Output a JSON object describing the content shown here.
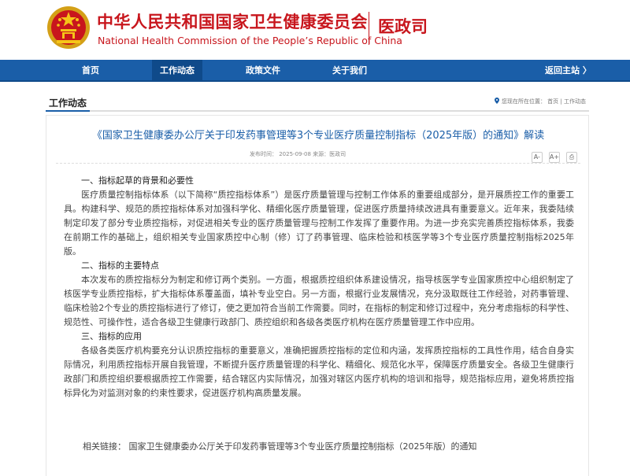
{
  "header": {
    "title_cn": "中华人民共和国国家卫生健康委员会",
    "title_en": "National Health Commission of the People’s Republic of China",
    "department": "医政司"
  },
  "nav": {
    "items": [
      "首页",
      "工作动态",
      "政策文件",
      "关于我们"
    ],
    "back": "返回主站 〉"
  },
  "section": {
    "title": "工作动态",
    "breadcrumb": "您现在所在位置：  首页 | 工作动态"
  },
  "article": {
    "title": "《国家卫生健康委办公厅关于印发药事管理等3个专业医疗质量控制指标（2025年版）的通知》解读",
    "meta": "发布时间：  2025-09-08     来源：医政司",
    "tools": [
      "A-",
      "A+",
      "⎙"
    ],
    "sections": [
      {
        "heading": "一、指标起草的背景和必要性",
        "paragraph": "医疗质量控制指标体系（以下简称“质控指标体系”）是医疗质量管理与控制工作体系的重要组成部分，是开展质控工作的重要工具。构建科学、规范的质控指标体系对加强科学化、精细化医疗质量管理，促进医疗质量持续改进具有重要意义。近年来，我委陆续制定印发了部分专业质控指标，对促进相关专业的医疗质量管理与控制工作发挥了重要作用。为进一步充实完善质控指标体系，我委在前期工作的基础上，组织相关专业国家质控中心制（修）订了药事管理、临床检验和核医学等3个专业医疗质量控制指标2025年版。"
      },
      {
        "heading": "二、指标的主要特点",
        "paragraph": "本次发布的质控指标分为制定和修订两个类别。一方面，根据质控组织体系建设情况，指导核医学专业国家质控中心组织制定了核医学专业质控指标，扩大指标体系覆盖面，填补专业空白。另一方面，根据行业发展情况，充分汲取既往工作经验，对药事管理、临床检验2个专业的质控指标进行了修订，使之更加符合当前工作需要。同时，在指标的制定和修订过程中，充分考虑指标的科学性、规范性、可操作性，适合各级卫生健康行政部门、质控组织和各级各类医疗机构在医疗质量管理工作中应用。"
      },
      {
        "heading": "三、指标的应用",
        "paragraph": "各级各类医疗机构要充分认识质控指标的重要意义，准确把握质控指标的定位和内涵，发挥质控指标的工具性作用，结合自身实际情况，利用质控指标开展自我管理，不断提升医疗质量管理的科学化、精细化、规范化水平，保障医疗质量安全。各级卫生健康行政部门和质控组织要根据质控工作需要，结合辖区内实际情况，加强对辖区内医疗机构的培训和指导，规范指标应用，避免将质控指标异化为对监测对象的约束性要求，促进医疗机构高质量发展。"
      }
    ],
    "related": "相关链接：  国家卫生健康委办公厅关于印发药事管理等3个专业医疗质量控制指标（2025年版）的通知"
  }
}
